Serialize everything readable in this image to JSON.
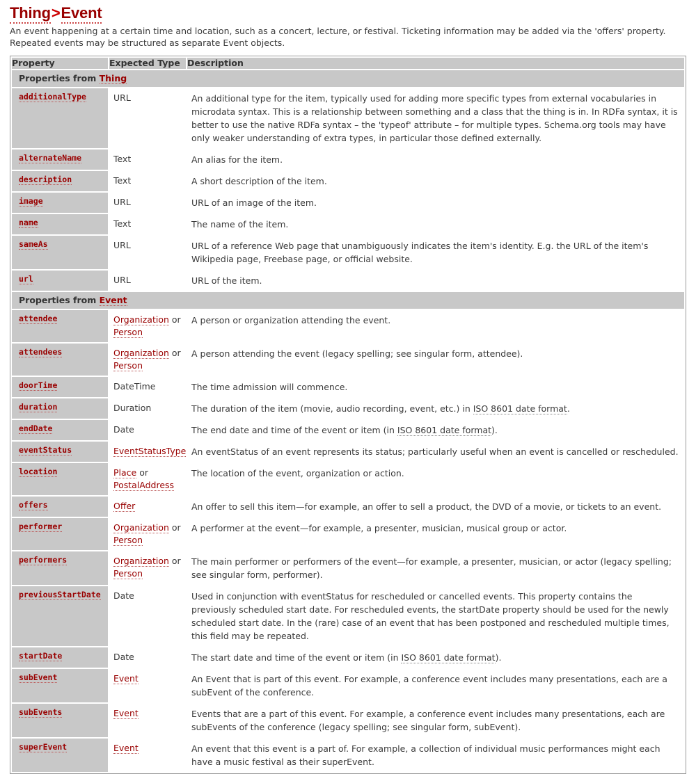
{
  "heading": {
    "parent_label": "Thing",
    "separator": ">",
    "type_label": "Event",
    "description": "An event happening at a certain time and location, such as a concert, lecture, or festival. Ticketing information may be added via the 'offers' property. Repeated events may be structured as separate Event objects."
  },
  "table": {
    "columns": {
      "property": "Property",
      "expected_type": "Expected Type",
      "description": "Description"
    },
    "sections": [
      {
        "label_prefix": "Properties from ",
        "label_link": "Thing",
        "rows": [
          {
            "property": "additionalType",
            "type_parts": [
              {
                "text": "URL",
                "link": false
              }
            ],
            "desc_parts": [
              {
                "text": "An additional type for the item, typically used for adding more specific types from external vocabularies in microdata syntax. This is a relationship between something and a class that the thing is in. In RDFa syntax, it is better to use the native RDFa syntax – the 'typeof' attribute – for multiple types. Schema.org tools may have only weaker understanding of extra types, in particular those defined externally.",
                "link": false
              }
            ]
          },
          {
            "property": "alternateName",
            "type_parts": [
              {
                "text": "Text",
                "link": false
              }
            ],
            "desc_parts": [
              {
                "text": "An alias for the item.",
                "link": false
              }
            ]
          },
          {
            "property": "description",
            "type_parts": [
              {
                "text": "Text",
                "link": false
              }
            ],
            "desc_parts": [
              {
                "text": "A short description of the item.",
                "link": false
              }
            ]
          },
          {
            "property": "image",
            "type_parts": [
              {
                "text": "URL",
                "link": false
              }
            ],
            "desc_parts": [
              {
                "text": "URL of an image of the item.",
                "link": false
              }
            ]
          },
          {
            "property": "name",
            "type_parts": [
              {
                "text": "Text",
                "link": false
              }
            ],
            "desc_parts": [
              {
                "text": "The name of the item.",
                "link": false
              }
            ]
          },
          {
            "property": "sameAs",
            "type_parts": [
              {
                "text": "URL",
                "link": false
              }
            ],
            "desc_parts": [
              {
                "text": "URL of a reference Web page that unambiguously indicates the item's identity. E.g. the URL of the item's Wikipedia page, Freebase page, or official website.",
                "link": false
              }
            ]
          },
          {
            "property": "url",
            "type_parts": [
              {
                "text": "URL",
                "link": false
              }
            ],
            "desc_parts": [
              {
                "text": "URL of the item.",
                "link": false
              }
            ]
          }
        ]
      },
      {
        "label_prefix": "Properties from ",
        "label_link": "Event",
        "rows": [
          {
            "property": "attendee",
            "type_parts": [
              {
                "text": "Organization",
                "link": true
              },
              {
                "text": " or ",
                "link": false
              },
              {
                "text": "Person",
                "link": true
              }
            ],
            "desc_parts": [
              {
                "text": "A person or organization attending the event.",
                "link": false
              }
            ]
          },
          {
            "property": "attendees",
            "type_parts": [
              {
                "text": "Organization",
                "link": true
              },
              {
                "text": " or ",
                "link": false
              },
              {
                "text": "Person",
                "link": true
              }
            ],
            "desc_parts": [
              {
                "text": "A person attending the event (legacy spelling; see singular form, attendee).",
                "link": false
              }
            ]
          },
          {
            "property": "doorTime",
            "type_parts": [
              {
                "text": "DateTime",
                "link": false
              }
            ],
            "desc_parts": [
              {
                "text": "The time admission will commence.",
                "link": false
              }
            ]
          },
          {
            "property": "duration",
            "type_parts": [
              {
                "text": "Duration",
                "link": false
              }
            ],
            "desc_parts": [
              {
                "text": "The duration of the item (movie, audio recording, event, etc.) in ",
                "link": false
              },
              {
                "text": "ISO 8601 date format",
                "link": true
              },
              {
                "text": ".",
                "link": false
              }
            ]
          },
          {
            "property": "endDate",
            "type_parts": [
              {
                "text": "Date",
                "link": false
              }
            ],
            "desc_parts": [
              {
                "text": "The end date and time of the event or item (in ",
                "link": false
              },
              {
                "text": "ISO 8601 date format",
                "link": true
              },
              {
                "text": ").",
                "link": false
              }
            ]
          },
          {
            "property": "eventStatus",
            "type_parts": [
              {
                "text": "EventStatusType",
                "link": true
              }
            ],
            "desc_parts": [
              {
                "text": "An eventStatus of an event represents its status; particularly useful when an event is cancelled or rescheduled.",
                "link": false
              }
            ]
          },
          {
            "property": "location",
            "type_parts": [
              {
                "text": "Place",
                "link": true
              },
              {
                "text": " or ",
                "link": false
              },
              {
                "text": "PostalAddress",
                "link": true
              }
            ],
            "desc_parts": [
              {
                "text": "The location of the event, organization or action.",
                "link": false
              }
            ]
          },
          {
            "property": "offers",
            "type_parts": [
              {
                "text": "Offer",
                "link": true
              }
            ],
            "desc_parts": [
              {
                "text": "An offer to sell this item—for example, an offer to sell a product, the DVD of a movie, or tickets to an event.",
                "link": false
              }
            ]
          },
          {
            "property": "performer",
            "type_parts": [
              {
                "text": "Organization",
                "link": true
              },
              {
                "text": " or ",
                "link": false
              },
              {
                "text": "Person",
                "link": true
              }
            ],
            "desc_parts": [
              {
                "text": "A performer at the event—for example, a presenter, musician, musical group or actor.",
                "link": false
              }
            ]
          },
          {
            "property": "performers",
            "type_parts": [
              {
                "text": "Organization",
                "link": true
              },
              {
                "text": " or ",
                "link": false
              },
              {
                "text": "Person",
                "link": true
              }
            ],
            "desc_parts": [
              {
                "text": "The main performer or performers of the event—for example, a presenter, musician, or actor (legacy spelling; see singular form, performer).",
                "link": false
              }
            ]
          },
          {
            "property": "previousStartDate",
            "type_parts": [
              {
                "text": "Date",
                "link": false
              }
            ],
            "desc_parts": [
              {
                "text": "Used in conjunction with eventStatus for rescheduled or cancelled events. This property contains the previously scheduled start date. For rescheduled events, the startDate property should be used for the newly scheduled start date. In the (rare) case of an event that has been postponed and rescheduled multiple times, this field may be repeated.",
                "link": false
              }
            ]
          },
          {
            "property": "startDate",
            "type_parts": [
              {
                "text": "Date",
                "link": false
              }
            ],
            "desc_parts": [
              {
                "text": "The start date and time of the event or item (in ",
                "link": false
              },
              {
                "text": "ISO 8601 date format",
                "link": true
              },
              {
                "text": ").",
                "link": false
              }
            ]
          },
          {
            "property": "subEvent",
            "type_parts": [
              {
                "text": "Event",
                "link": true
              }
            ],
            "desc_parts": [
              {
                "text": "An Event that is part of this event. For example, a conference event includes many presentations, each are a subEvent of the conference.",
                "link": false
              }
            ]
          },
          {
            "property": "subEvents",
            "type_parts": [
              {
                "text": "Event",
                "link": true
              }
            ],
            "desc_parts": [
              {
                "text": "Events that are a part of this event. For example, a conference event includes many presentations, each are subEvents of the conference (legacy spelling; see singular form, subEvent).",
                "link": false
              }
            ]
          },
          {
            "property": "superEvent",
            "type_parts": [
              {
                "text": "Event",
                "link": true
              }
            ],
            "desc_parts": [
              {
                "text": "An event that this event is a part of. For example, a collection of individual music performances might each have a music festival as their superEvent.",
                "link": false
              }
            ]
          }
        ]
      }
    ]
  }
}
